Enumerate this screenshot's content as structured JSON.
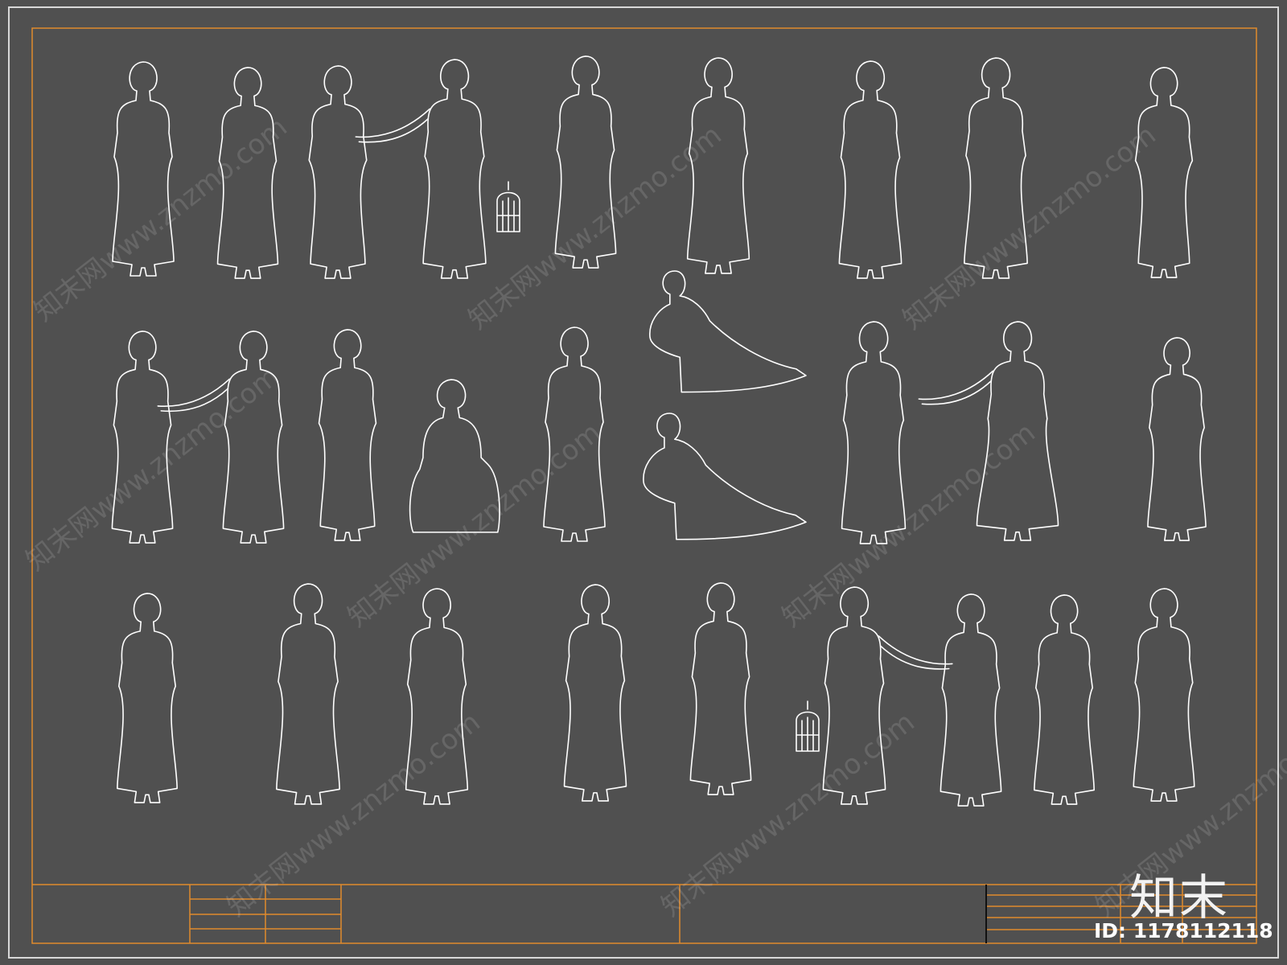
{
  "brand": {
    "name": "知末",
    "id_label": "ID: 1178112118"
  },
  "watermark": {
    "text": "知末网www.znzmo.com"
  },
  "colors": {
    "background": "#505050",
    "frame": "#e08a2c",
    "outline": "#ffffff",
    "outer_border": "#d8d8d8"
  },
  "drawing": {
    "subject": "figure-outline",
    "rows": [
      {
        "row": 1,
        "figures": [
          "woman-holding-fan",
          "woman-front",
          "woman-side-with-bag",
          "woman-pointing-with-birdcage",
          "woman-holding-flower",
          "woman-front",
          "woman-front",
          "woman-front",
          "woman-back"
        ]
      },
      {
        "row": 2,
        "figures": [
          "woman-front",
          "woman-reaching",
          "woman-side",
          "woman-seated",
          "woman-front",
          "woman-reclining",
          "woman-reclining",
          "woman-front",
          "woman-reaching",
          "woman-side"
        ]
      },
      {
        "row": 3,
        "figures": [
          "woman-back",
          "woman-front",
          "woman-front",
          "woman-front",
          "woman-holding-flower",
          "woman-holding-birdcage",
          "woman-side",
          "woman-front",
          "woman-holding-fan"
        ]
      }
    ]
  }
}
